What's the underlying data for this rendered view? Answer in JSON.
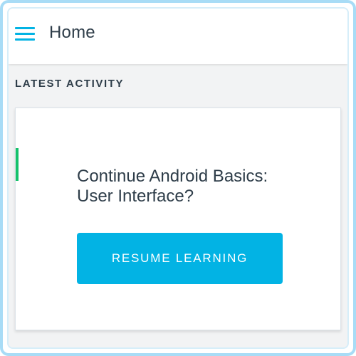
{
  "app_bar": {
    "title": "Home",
    "menu_icon": "hamburger-menu-icon"
  },
  "section": {
    "label": "LATEST ACTIVITY"
  },
  "card": {
    "title": "Continue Android Basics: User Interface?",
    "button_label": "RESUME LEARNING"
  },
  "colors": {
    "accent": "#02b3e4",
    "progress_marker": "#15c26b",
    "text": "#2e3d49",
    "frame_border": "#a8dcf6",
    "background": "#f2f3f4"
  }
}
